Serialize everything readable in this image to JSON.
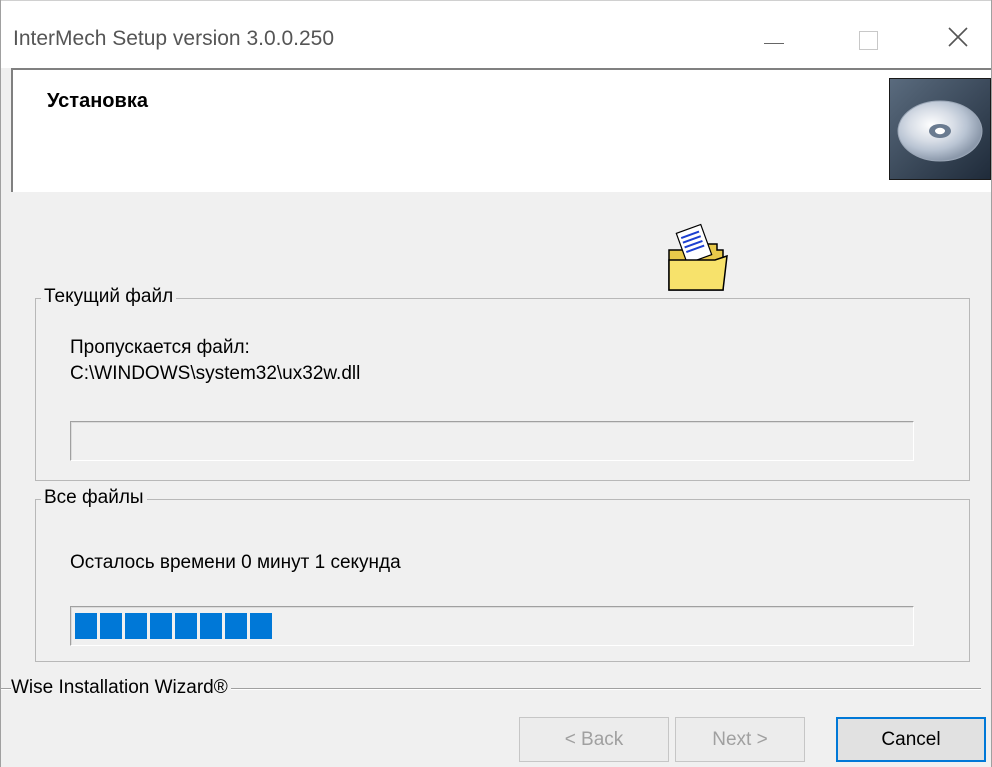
{
  "window": {
    "title": "InterMech Setup version 3.0.0.250",
    "controls": {
      "minimize": "minimize-icon",
      "maximize": "maximize-icon",
      "close": "close-icon"
    }
  },
  "header": {
    "title": "Установка",
    "icon": "cd-disc-icon"
  },
  "copy_icon": "folder-with-file-icon",
  "current_file": {
    "legend": "Текущий файл",
    "line1": "Пропускается файл:",
    "line2": "C:\\WINDOWS\\system32\\ux32w.dll",
    "progress_fraction": 0
  },
  "all_files": {
    "legend": "Все файлы",
    "time_remaining": "Осталось времени 0 минут 1 секунда",
    "progress_fraction": 0.24
  },
  "footer": {
    "brand": "Wise Installation Wizard®"
  },
  "buttons": {
    "back": "< Back",
    "next": "Next >",
    "cancel": "Cancel"
  },
  "colors": {
    "progress_fill": "#0078d7",
    "window_bg": "#f0f0f0",
    "header_bg": "#ffffff"
  }
}
